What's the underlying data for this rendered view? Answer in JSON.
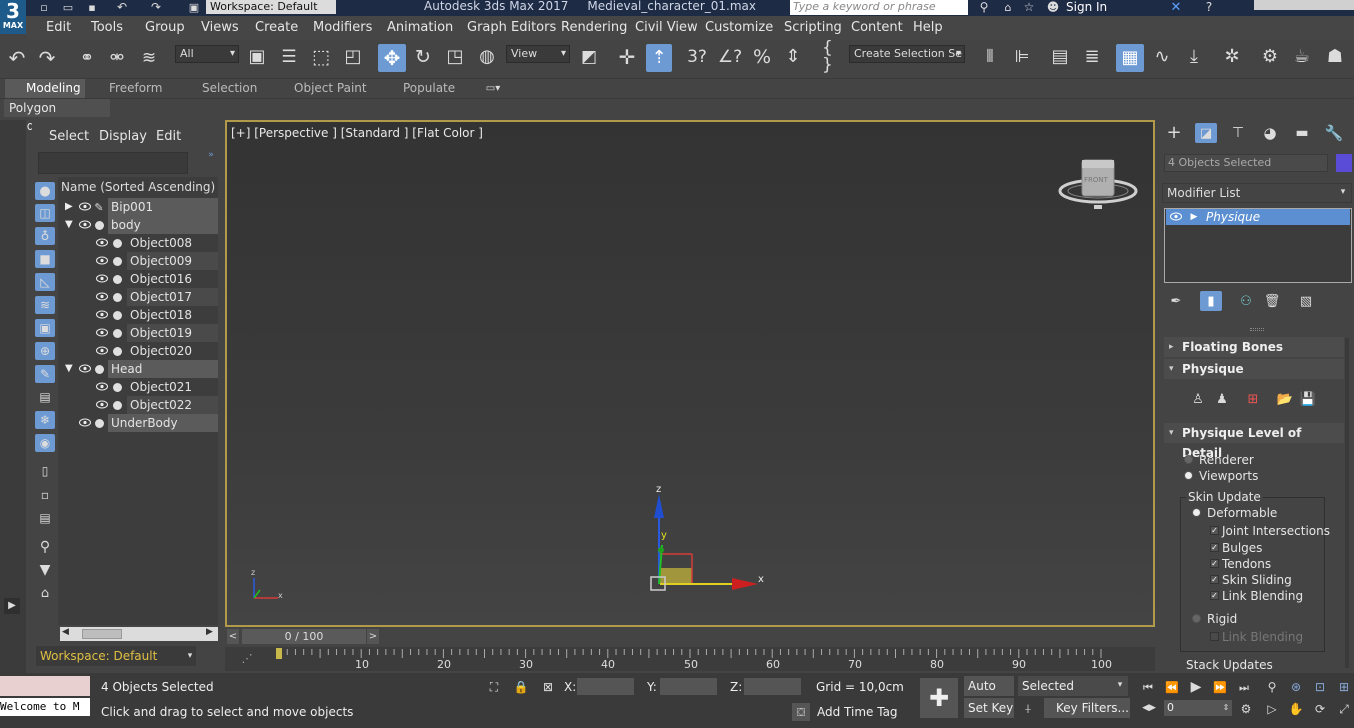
{
  "titlebar": {
    "workspace": "Workspace: Default",
    "title": "Autodesk 3ds Max 2017     Medieval_character_01.max",
    "search_placeholder": "Type a keyword or phrase",
    "sign_in": "Sign In",
    "logo": "3",
    "logo_sub": "MAX"
  },
  "menu": [
    "Edit",
    "Tools",
    "Group",
    "Views",
    "Create",
    "Modifiers",
    "Animation",
    "Graph Editors",
    "Rendering",
    "Civil View",
    "Customize",
    "Scripting",
    "Content",
    "Help"
  ],
  "toolbar": {
    "filter": "All",
    "ref_coord": "View",
    "selection_set": "Create Selection Se"
  },
  "ribbon": {
    "tabs": [
      "Modeling",
      "Freeform",
      "Selection",
      "Object Paint",
      "Populate"
    ],
    "active": "Modeling",
    "subtab": "Polygon Modeling"
  },
  "explorer": {
    "menu": [
      "Select",
      "Display",
      "Edit"
    ],
    "header": "Name (Sorted Ascending)",
    "rows": [
      {
        "name": "Bip001"
      },
      {
        "name": "body"
      },
      {
        "name": "Object008"
      },
      {
        "name": "Object009"
      },
      {
        "name": "Object016"
      },
      {
        "name": "Object017"
      },
      {
        "name": "Object018"
      },
      {
        "name": "Object019"
      },
      {
        "name": "Object020"
      },
      {
        "name": "Head"
      },
      {
        "name": "Object021"
      },
      {
        "name": "Object022"
      },
      {
        "name": "UnderBody"
      }
    ],
    "workspace": "Workspace: Default"
  },
  "viewport": {
    "label": "[+] [Perspective ] [Standard ] [Flat Color ]",
    "viewcube_face": "FRONT",
    "axis_x": "x",
    "axis_y": "y",
    "axis_z": "z"
  },
  "timeline": {
    "frame": "0 / 100",
    "ticks": [
      "10",
      "20",
      "30",
      "40",
      "50",
      "60",
      "70",
      "80",
      "90",
      "100"
    ]
  },
  "command_panel": {
    "object_name": "4 Objects Selected",
    "modifier_list": "Modifier List",
    "stack_item": "Physique",
    "rollouts": {
      "floating_bones": "Floating Bones",
      "physique": "Physique",
      "lod": "Physique Level of Detail"
    },
    "renderer": "Renderer",
    "viewports": "Viewports",
    "skin_update": "Skin Update",
    "deformable": "Deformable",
    "checks": [
      "Joint Intersections",
      "Bulges",
      "Tendons",
      "Skin Sliding",
      "Link Blending"
    ],
    "rigid": "Rigid",
    "rigid_link": "Link Blending",
    "stack_updates": "Stack Updates"
  },
  "status": {
    "maxscript": "Welcome to M",
    "selected": "4 Objects Selected",
    "prompt": "Click and drag to select and move objects",
    "x_label": "X:",
    "y_label": "Y:",
    "z_label": "Z:",
    "grid": "Grid = 10,0cm",
    "add_time_tag": "Add Time Tag",
    "auto_key": "Auto Key",
    "set_key": "Set Key",
    "key_mode": "Selected",
    "key_filters": "Key Filters...",
    "frame": "0"
  },
  "colors": {
    "accent": "#6e9ad3",
    "viewport_border": "#b39a4a",
    "object_color": "#5a4cd6"
  }
}
